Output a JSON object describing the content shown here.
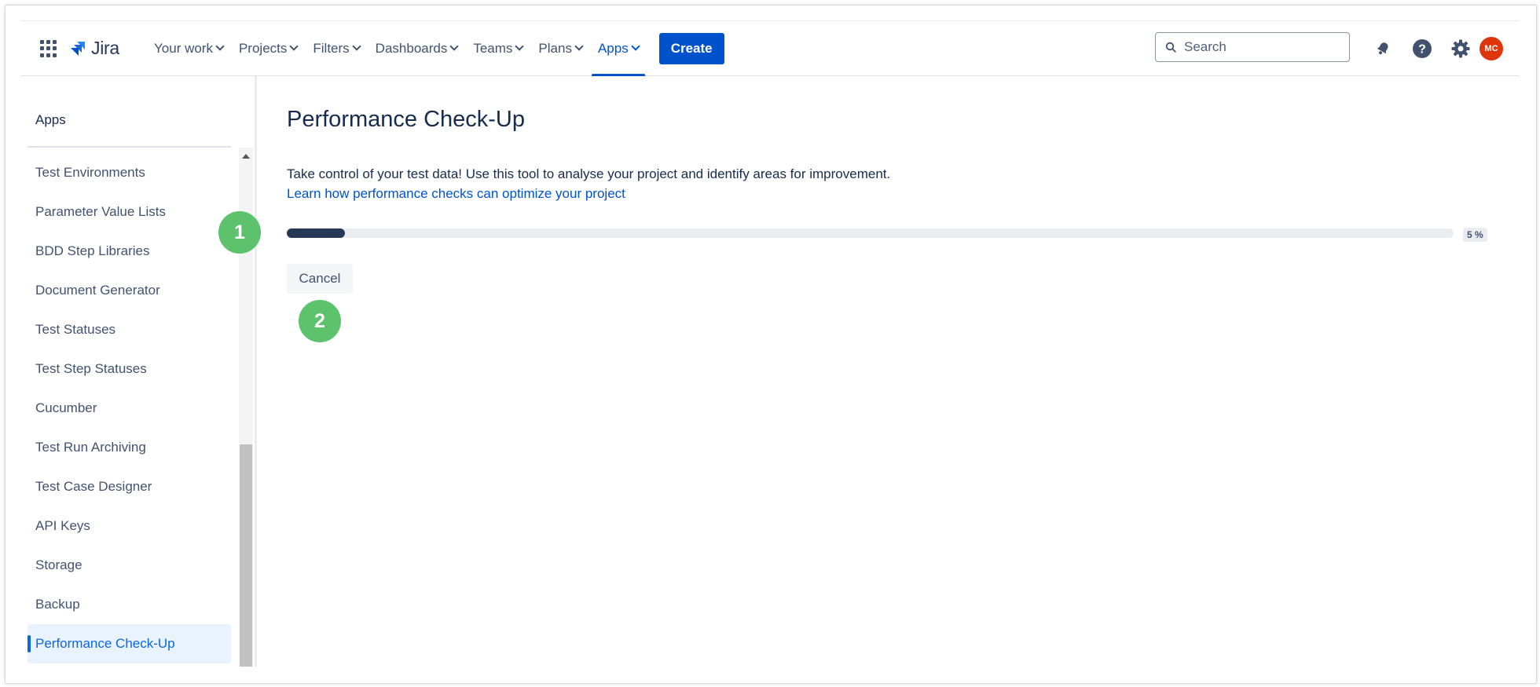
{
  "header": {
    "logo_text": "Jira",
    "nav": [
      {
        "label": "Your work",
        "active": false
      },
      {
        "label": "Projects",
        "active": false
      },
      {
        "label": "Filters",
        "active": false
      },
      {
        "label": "Dashboards",
        "active": false
      },
      {
        "label": "Teams",
        "active": false
      },
      {
        "label": "Plans",
        "active": false
      },
      {
        "label": "Apps",
        "active": true
      }
    ],
    "create_label": "Create",
    "search_placeholder": "Search",
    "avatar_initials": "MC"
  },
  "sidebar": {
    "title": "Apps",
    "items": [
      {
        "label": "Test Environments"
      },
      {
        "label": "Parameter Value Lists"
      },
      {
        "label": "BDD Step Libraries"
      },
      {
        "label": "Document Generator"
      },
      {
        "label": "Test Statuses"
      },
      {
        "label": "Test Step Statuses"
      },
      {
        "label": "Cucumber"
      },
      {
        "label": "Test Run Archiving"
      },
      {
        "label": "Test Case Designer"
      },
      {
        "label": "API Keys"
      },
      {
        "label": "Storage"
      },
      {
        "label": "Backup"
      },
      {
        "label": "Performance Check-Up"
      }
    ],
    "active_item": "Performance Check-Up"
  },
  "main": {
    "title": "Performance Check-Up",
    "description": "Take control of your test data! Use this tool to analyse your project and identify areas for improvement.",
    "learn_link": "Learn how performance checks can optimize your project",
    "progress": {
      "value": 0.05,
      "label": "5 %"
    },
    "cancel_label": "Cancel"
  },
  "annotations": {
    "marker_1": "1",
    "marker_2": "2"
  },
  "colors": {
    "brand_blue": "#0052cc",
    "progress_fill": "#253858",
    "marker_green": "#5cc36c",
    "avatar_bg": "#de350b"
  }
}
